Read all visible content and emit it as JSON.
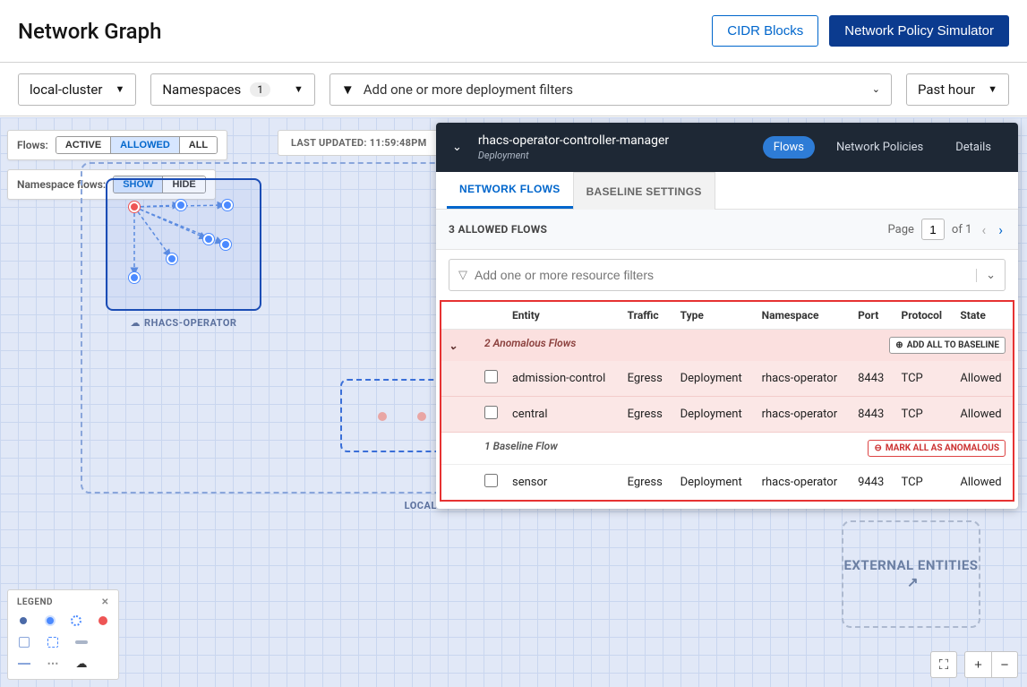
{
  "header": {
    "title": "Network Graph",
    "cidr_btn": "CIDR Blocks",
    "sim_btn": "Network Policy Simulator"
  },
  "filters": {
    "cluster": "local-cluster",
    "namespaces_label": "Namespaces",
    "namespaces_count": "1",
    "deploy_placeholder": "Add one or more deployment filters",
    "time": "Past hour"
  },
  "overlays": {
    "flows_label": "Flows:",
    "flows_opts": {
      "active": "ACTIVE",
      "allowed": "ALLOWED",
      "all": "ALL"
    },
    "nsflows_label": "Namespace flows:",
    "nsflows_opts": {
      "show": "SHOW",
      "hide": "HIDE"
    },
    "last_updated": "LAST UPDATED: 11:59:48PM"
  },
  "graph": {
    "ns_label": "RHACS-OPERATOR",
    "cluster_label": "LOCAL-CLU",
    "external_label": "EXTERNAL ENTITIES"
  },
  "panel": {
    "title": "rhacs-operator-controller-manager",
    "subtitle": "Deployment",
    "tabs": {
      "flows": "Flows",
      "policies": "Network Policies",
      "details": "Details"
    },
    "subtabs": {
      "flows": "NETWORK FLOWS",
      "baseline": "BASELINE SETTINGS"
    },
    "count_text": "3 ALLOWED FLOWS",
    "page_label": "Page",
    "page_value": "1",
    "page_of": "of 1",
    "filter_placeholder": "Add one or more resource filters",
    "columns": {
      "entity": "Entity",
      "traffic": "Traffic",
      "type": "Type",
      "namespace": "Namespace",
      "port": "Port",
      "protocol": "Protocol",
      "state": "State"
    },
    "groups": {
      "anomalous": {
        "label": "2 Anomalous Flows",
        "btn": "ADD ALL TO BASELINE"
      },
      "baseline": {
        "label": "1 Baseline Flow",
        "btn": "MARK ALL AS ANOMALOUS"
      }
    },
    "rows": {
      "r0": {
        "entity": "admission-control",
        "traffic": "Egress",
        "type": "Deployment",
        "ns": "rhacs-operator",
        "port": "8443",
        "proto": "TCP",
        "state": "Allowed"
      },
      "r1": {
        "entity": "central",
        "traffic": "Egress",
        "type": "Deployment",
        "ns": "rhacs-operator",
        "port": "8443",
        "proto": "TCP",
        "state": "Allowed"
      },
      "r2": {
        "entity": "sensor",
        "traffic": "Egress",
        "type": "Deployment",
        "ns": "rhacs-operator",
        "port": "9443",
        "proto": "TCP",
        "state": "Allowed"
      }
    }
  },
  "legend": {
    "title": "LEGEND"
  }
}
